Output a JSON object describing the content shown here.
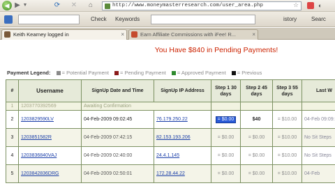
{
  "browser": {
    "url": "http://www.moneymasterresearch.com/user_area.php",
    "nav": {
      "back": "◀",
      "forward": "▶",
      "dropdown": "▼",
      "reload": "⟳",
      "stop": "✕",
      "home": "⌂"
    },
    "search_placeholder": "",
    "check_label": "Check",
    "keywords_label": "Keywords",
    "history_label": "istory",
    "search_right_label": "Searc"
  },
  "tabs": [
    {
      "label": "Keith Kearney logged in",
      "active": true
    },
    {
      "label": "Earn Affiliate Commissions with iFee! R...",
      "active": false
    }
  ],
  "page": {
    "banner": "You Have $840 in Pending Payments!",
    "legend": {
      "title": "Payment Legend:",
      "items": [
        {
          "label": "= Potential Payment",
          "color": "#8a8a8a"
        },
        {
          "label": "= Pending Payment",
          "color": "#8b1a1a"
        },
        {
          "label": "= Approved Payment",
          "color": "#2e8a2e"
        },
        {
          "label": "= Previous",
          "color": "#111111"
        }
      ]
    },
    "table": {
      "headers": [
        "#",
        "Username",
        "SignUp Date and Time",
        "SignUp IP Address",
        "Step 1 30 days",
        "Step 2 45 days",
        "Step 3 55 days",
        "Last W"
      ],
      "rows": [
        {
          "num": "1",
          "username": "1203770392569",
          "date": "Awaiting Confirmation",
          "ip": "",
          "s1": "",
          "s2": "",
          "s3": "",
          "last": "",
          "kind": "pending"
        },
        {
          "num": "2",
          "username": "1203829590LV",
          "date": "04-Feb-2009 09:02:45",
          "ip": "76.179.250.22",
          "s1": "= $0.00",
          "s2": "$40",
          "s3": "= $10.00",
          "last": "04-Feb 09:09:1",
          "kind": "b"
        },
        {
          "num": "3",
          "username": "1203851582R",
          "date": "04-Feb-2009 07:42:15",
          "ip": "82.153.193.206",
          "s1": "= $0.00",
          "s2": "= $0.00",
          "s3": "= $10.00",
          "last": "No Sit Steps",
          "kind": "a"
        },
        {
          "num": "4",
          "username": "1203836840VAJ",
          "date": "04-Feb-2009 02:40:00",
          "ip": "24.4.1.145",
          "s1": "= $0.00",
          "s2": "= $0.00",
          "s3": "= $10.00",
          "last": "No Sit Steps",
          "kind": "b"
        },
        {
          "num": "5",
          "username": "1203842836DRG",
          "date": "04-Feb-2009 02:50:01",
          "ip": "172.28.44.22",
          "s1": "= $0.00",
          "s2": "= $0.00",
          "s3": "= $10.00",
          "last": "04-Feb",
          "kind": "a"
        }
      ]
    }
  }
}
